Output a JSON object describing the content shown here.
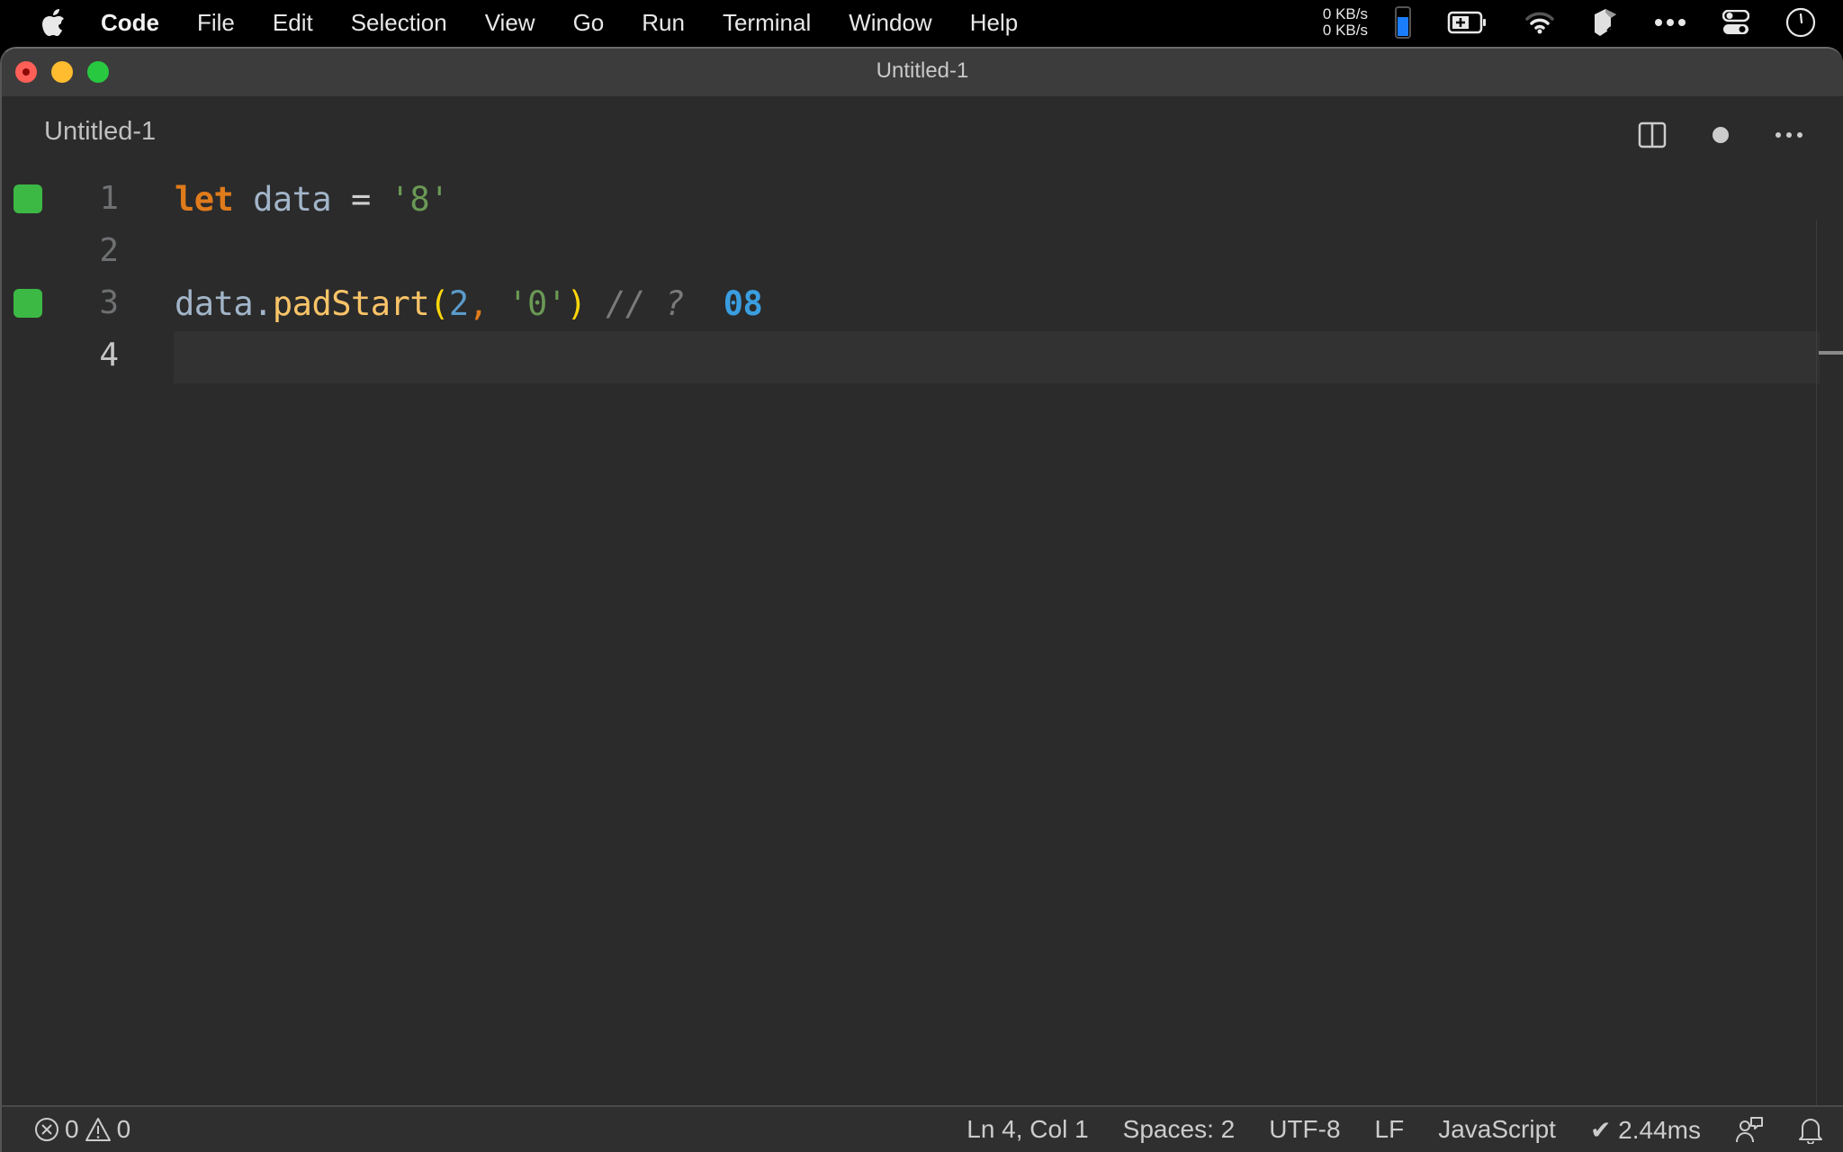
{
  "menubar": {
    "app_name": "Code",
    "items": [
      "File",
      "Edit",
      "Selection",
      "View",
      "Go",
      "Run",
      "Terminal",
      "Window",
      "Help"
    ],
    "net_up": "0 KB/s",
    "net_down": "0 KB/s",
    "tray_icons": [
      "memory-gauge-icon",
      "battery-icon",
      "wifi-icon",
      "app-extension-icon",
      "more-icon",
      "control-center-icon",
      "clock-icon"
    ]
  },
  "window": {
    "title": "Untitled-1"
  },
  "editor": {
    "tab_label": "Untitled-1",
    "actions": [
      "split-editor",
      "unsaved-indicator",
      "more-actions"
    ],
    "lines": [
      {
        "number": "1",
        "marker": true,
        "tokens": [
          {
            "t": "let",
            "c": "kw"
          },
          {
            "t": " ",
            "c": "op"
          },
          {
            "t": "data",
            "c": "var"
          },
          {
            "t": " = ",
            "c": "op"
          },
          {
            "t": "'8'",
            "c": "str"
          }
        ]
      },
      {
        "number": "2",
        "marker": false,
        "tokens": []
      },
      {
        "number": "3",
        "marker": true,
        "tokens": [
          {
            "t": "data",
            "c": "var"
          },
          {
            "t": ".",
            "c": "var"
          },
          {
            "t": "padStart",
            "c": "fn"
          },
          {
            "t": "(",
            "c": "paren"
          },
          {
            "t": "2",
            "c": "num"
          },
          {
            "t": ",",
            "c": "punct"
          },
          {
            "t": " ",
            "c": "op"
          },
          {
            "t": "'0'",
            "c": "str"
          },
          {
            "t": ")",
            "c": "paren"
          },
          {
            "t": " // ? ",
            "c": "comment"
          },
          {
            "t": " 08",
            "c": "result"
          }
        ]
      },
      {
        "number": "4",
        "marker": false,
        "current": true,
        "tokens": []
      }
    ],
    "marker_color": "#3cb945"
  },
  "statusbar": {
    "errors": "0",
    "warnings": "0",
    "cursor": "Ln 4, Col 1",
    "indent": "Spaces: 2",
    "encoding": "UTF-8",
    "eol": "LF",
    "language": "JavaScript",
    "timing": "✔ 2.44ms"
  }
}
